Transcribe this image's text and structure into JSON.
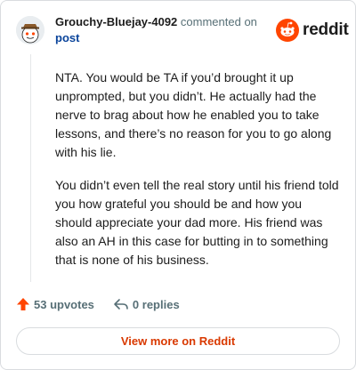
{
  "comment": {
    "author": "Grouchy-Bluejay-4092",
    "action": "commented on",
    "target": "post",
    "paragraphs": [
      "NTA. You would be TA if you’d brought it up unprompted, but you didn’t. He actually had the nerve to brag about how he enabled you to take lessons, and there’s no reason for you to go along with his lie.",
      "You didn’t even tell the real story until his friend told you how grateful you should be and how you should appreciate your dad more. His friend was also an AH in this case for butting in to something that is none of his business."
    ],
    "upvotes_label": "53 upvotes",
    "replies_label": "0 replies"
  },
  "brand": {
    "wordmark": "reddit",
    "color": "#ff4500"
  },
  "footer": {
    "view_more_label": "View more on Reddit"
  },
  "icons": {
    "upvote": "upvote-arrow-icon",
    "reply": "reply-arrow-icon",
    "logo": "reddit-snoo-icon",
    "avatar": "snoo-avatar-icon"
  },
  "colors": {
    "accent": "#d93900",
    "link": "#0a449b",
    "muted": "#576f76",
    "upvote": "#ff4500"
  }
}
